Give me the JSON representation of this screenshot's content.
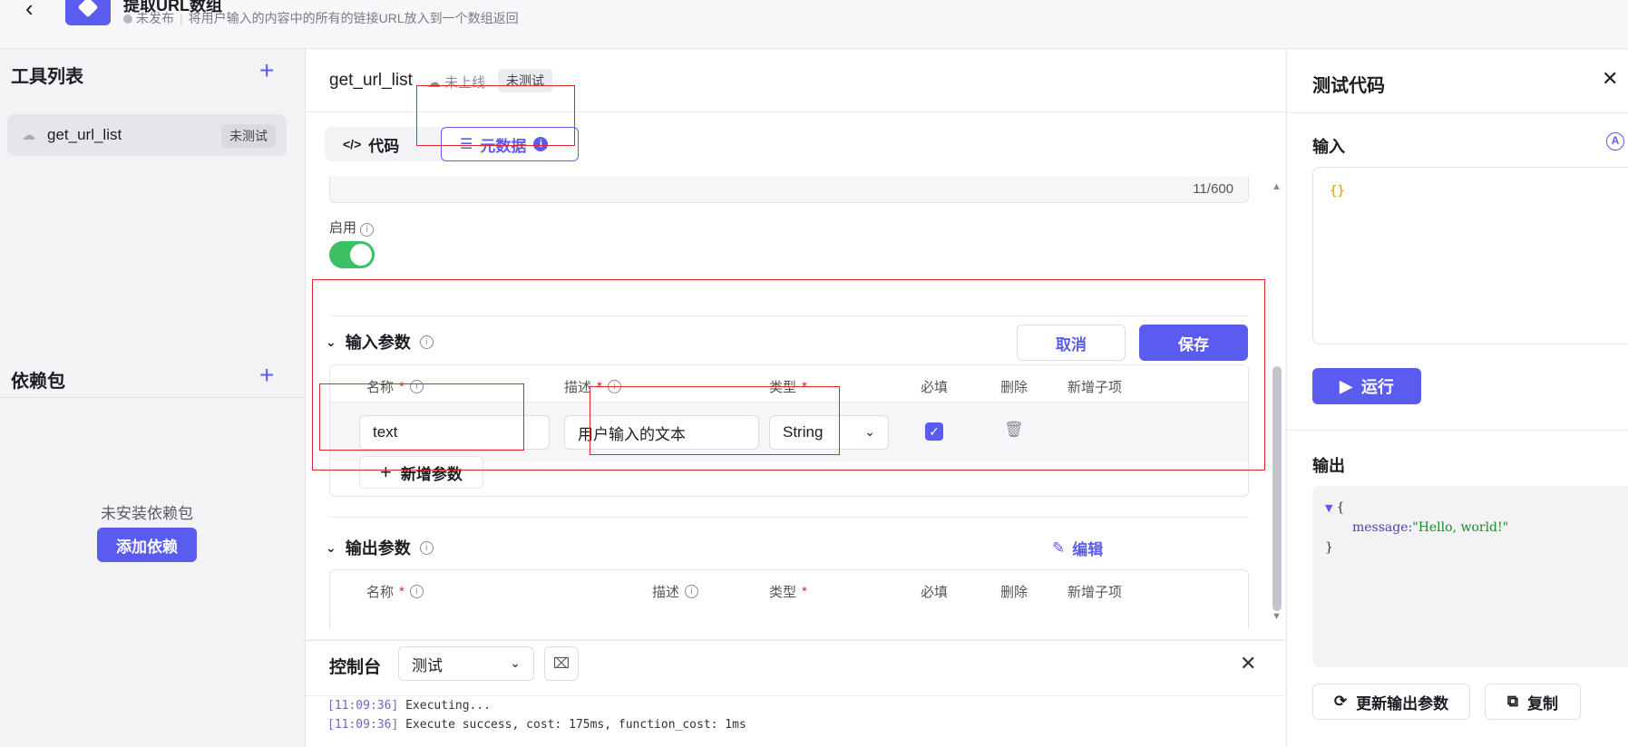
{
  "header": {
    "title": "提取URL数组",
    "status": "未发布",
    "description": "将用户输入的内容中的所有的链接URL放入到一个数组返回"
  },
  "sidebar": {
    "tools_title": "工具列表",
    "tools": [
      {
        "name": "get_url_list",
        "badge": "未测试"
      }
    ],
    "deps_title": "依赖包",
    "deps_empty": "未安装依赖包",
    "add_dep_label": "添加依赖"
  },
  "editor": {
    "tool_name": "get_url_list",
    "online_status": "未上线",
    "test_badge": "未测试",
    "tabs": {
      "code": "代码",
      "metadata": "元数据"
    },
    "counter": "11/600",
    "enable_label": "启用",
    "enabled": true,
    "input_params": {
      "title": "输入参数",
      "cancel_label": "取消",
      "save_label": "保存",
      "columns": {
        "name": "名称",
        "desc": "描述",
        "type": "类型",
        "required": "必填",
        "delete": "删除",
        "add_child": "新增子项"
      },
      "rows": [
        {
          "name": "text",
          "desc": "用户输入的文本",
          "type": "String",
          "required": true
        }
      ],
      "add_param_label": "新增参数"
    },
    "output_params": {
      "title": "输出参数",
      "edit_label": "编辑",
      "columns": {
        "name": "名称",
        "desc": "描述",
        "type": "类型",
        "required": "必填",
        "delete": "删除",
        "add_child": "新增子项"
      }
    }
  },
  "console": {
    "title": "控制台",
    "select_value": "测试",
    "logs": [
      {
        "ts": "[11:09:36]",
        "msg": " Executing..."
      },
      {
        "ts": "[11:09:36]",
        "msg": " Execute success, cost: 175ms, function_cost: 1ms"
      }
    ]
  },
  "test_panel": {
    "title": "测试代码",
    "input_label": "输入",
    "input_value": "{}",
    "run_label": "运行",
    "output_label": "输出",
    "output": {
      "open": "{",
      "key": "message:",
      "value": "\"Hello, world!\"",
      "close": "}"
    },
    "update_label": "更新输出参数",
    "copy_label": "复制"
  },
  "colors": {
    "accent": "#5a5cf0",
    "toggle_on": "#3cc064",
    "highlight": "#e0262b"
  }
}
